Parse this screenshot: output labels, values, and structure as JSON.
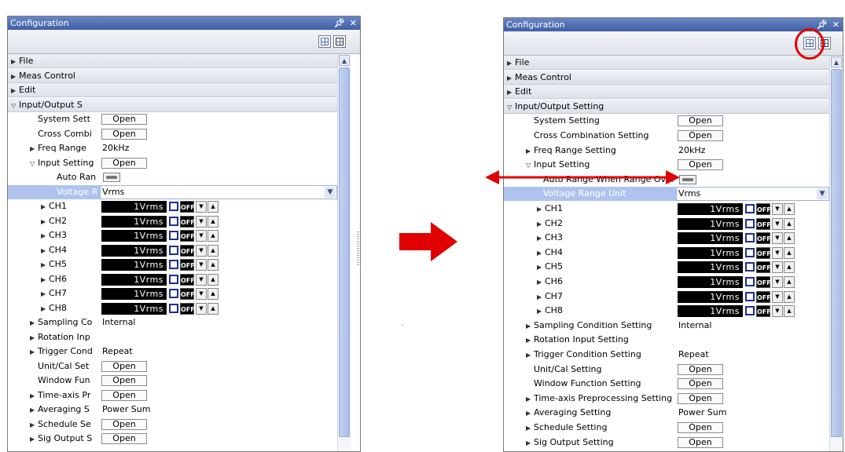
{
  "window": {
    "title": "Configuration",
    "pin_glyph": "4",
    "close_glyph": "✕"
  },
  "left": {
    "rows": [
      {
        "kind": "group",
        "label": "File"
      },
      {
        "kind": "group",
        "label": "Meas Control"
      },
      {
        "kind": "group",
        "label": "Edit"
      },
      {
        "kind": "group-open",
        "label": "Input/Output S"
      },
      {
        "kind": "item",
        "label": "System Sett",
        "button": "Open"
      },
      {
        "kind": "item",
        "label": "Cross Combi",
        "button": "Open"
      },
      {
        "kind": "item-arrow",
        "label": "Freq Range",
        "value": "20kHz"
      },
      {
        "kind": "item-open",
        "label": "Input Setting",
        "button": "Open"
      },
      {
        "kind": "toggle",
        "label": "Auto Ran"
      },
      {
        "kind": "select",
        "label": "Voltage R",
        "value": "Vrms"
      },
      {
        "kind": "ch",
        "label": "CH1",
        "value": "1Vrms",
        "off": "OFF"
      },
      {
        "kind": "ch",
        "label": "CH2",
        "value": "1Vrms",
        "off": "OFF"
      },
      {
        "kind": "ch",
        "label": "CH3",
        "value": "1Vrms",
        "off": "OFF"
      },
      {
        "kind": "ch",
        "label": "CH4",
        "value": "1Vrms",
        "off": "OFF"
      },
      {
        "kind": "ch",
        "label": "CH5",
        "value": "1Vrms",
        "off": "OFF"
      },
      {
        "kind": "ch",
        "label": "CH6",
        "value": "1Vrms",
        "off": "OFF"
      },
      {
        "kind": "ch",
        "label": "CH7",
        "value": "1Vrms",
        "off": "OFF"
      },
      {
        "kind": "ch",
        "label": "CH8",
        "value": "1Vrms",
        "off": "OFF"
      },
      {
        "kind": "item-arrow",
        "label": "Sampling Co",
        "value": "Internal"
      },
      {
        "kind": "item-arrow",
        "label": "Rotation Inp",
        "value": ""
      },
      {
        "kind": "item-arrow",
        "label": "Trigger Cond",
        "value": "Repeat"
      },
      {
        "kind": "item",
        "label": "Unit/Cal Set",
        "button": "Open"
      },
      {
        "kind": "item",
        "label": "Window Fun",
        "button": "Open"
      },
      {
        "kind": "item-arrow-btn",
        "label": "Time-axis Pr",
        "button": "Open"
      },
      {
        "kind": "item-arrow",
        "label": "Averaging S",
        "value": "Power Sum"
      },
      {
        "kind": "item-arrow-btn",
        "label": "Schedule Se",
        "button": "Open"
      },
      {
        "kind": "item-arrow-btn",
        "label": "Sig Output S",
        "button": "Open"
      }
    ]
  },
  "right": {
    "rows": [
      {
        "kind": "group",
        "label": "File"
      },
      {
        "kind": "group",
        "label": "Meas Control"
      },
      {
        "kind": "group",
        "label": "Edit"
      },
      {
        "kind": "group-open",
        "label": "Input/Output Setting"
      },
      {
        "kind": "item",
        "label": "System Setting",
        "button": "Open"
      },
      {
        "kind": "item",
        "label": "Cross Combination Setting",
        "button": "Open"
      },
      {
        "kind": "item-arrow",
        "label": "Freq Range Setting",
        "value": "20kHz"
      },
      {
        "kind": "item-open",
        "label": "Input Setting",
        "button": "Open"
      },
      {
        "kind": "toggle",
        "label": "Auto Range When Range Over"
      },
      {
        "kind": "select",
        "label": "Voltage Range Unit",
        "value": "Vrms"
      },
      {
        "kind": "ch",
        "label": "CH1",
        "value": "1Vrms",
        "off": "OFF"
      },
      {
        "kind": "ch",
        "label": "CH2",
        "value": "1Vrms",
        "off": "OFF"
      },
      {
        "kind": "ch",
        "label": "CH3",
        "value": "1Vrms",
        "off": "OFF"
      },
      {
        "kind": "ch",
        "label": "CH4",
        "value": "1Vrms",
        "off": "OFF"
      },
      {
        "kind": "ch",
        "label": "CH5",
        "value": "1Vrms",
        "off": "OFF"
      },
      {
        "kind": "ch",
        "label": "CH6",
        "value": "1Vrms",
        "off": "OFF"
      },
      {
        "kind": "ch",
        "label": "CH7",
        "value": "1Vrms",
        "off": "OFF"
      },
      {
        "kind": "ch",
        "label": "CH8",
        "value": "1Vrms",
        "off": "OFF"
      },
      {
        "kind": "item-arrow",
        "label": "Sampling Condition Setting",
        "value": "Internal"
      },
      {
        "kind": "item-arrow",
        "label": "Rotation Input Setting",
        "value": ""
      },
      {
        "kind": "item-arrow",
        "label": "Trigger Condition Setting",
        "value": "Repeat"
      },
      {
        "kind": "item",
        "label": "Unit/Cal Setting",
        "button": "Open"
      },
      {
        "kind": "item",
        "label": "Window Function Setting",
        "button": "Open"
      },
      {
        "kind": "item-arrow-btn",
        "label": "Time-axis Preprocessing Setting",
        "button": "Open"
      },
      {
        "kind": "item-arrow",
        "label": "Averaging Setting",
        "value": "Power Sum"
      },
      {
        "kind": "item-arrow-btn",
        "label": "Schedule Setting",
        "button": "Open"
      },
      {
        "kind": "item-arrow-btn",
        "label": "Sig Output Setting",
        "button": "Open"
      }
    ]
  },
  "colors": {
    "annotation": "#e00000",
    "titlebar": "#3f5fa6",
    "selected_row": "#aec3ee"
  },
  "icons": {
    "expand": "triangle-right",
    "collapse": "triangle-down",
    "scroll_up": "caret-up",
    "dropdown": "chevron-down"
  }
}
